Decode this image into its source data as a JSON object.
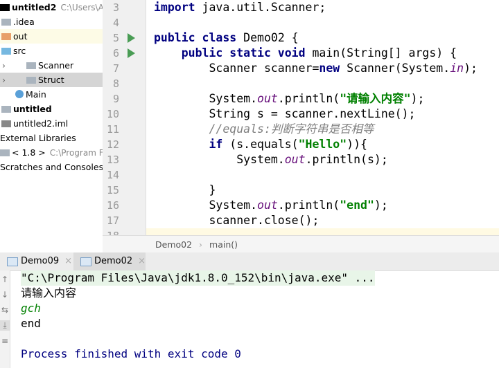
{
  "project_tree": [
    {
      "label": "untitled2",
      "hint": "C:\\Users\\Apple",
      "bold": true,
      "indent": 0,
      "icon": "folder-icon",
      "color": "#000"
    },
    {
      "label": ".idea",
      "indent": 1,
      "icon": "folder-icon",
      "color": "#aab4be"
    },
    {
      "label": "out",
      "indent": 1,
      "icon": "folder-orange-icon",
      "color": "#e8a06a",
      "highlight": true
    },
    {
      "label": "src",
      "indent": 1,
      "icon": "folder-blue-icon",
      "color": "#76b8e0"
    },
    {
      "label": "Scanner",
      "indent": 2,
      "icon": "package-icon",
      "color": "#aab4be",
      "arrow": true
    },
    {
      "label": "Struct",
      "indent": 2,
      "icon": "package-icon",
      "color": "#aab4be",
      "arrow": true,
      "selected": true
    },
    {
      "label": "Main",
      "indent": 2,
      "icon": "class-icon",
      "color": "#5aa0d8"
    },
    {
      "label": "untitled",
      "indent": 1,
      "icon": "module-icon",
      "bold": true,
      "color": "#aab4be"
    },
    {
      "label": "untitled2.iml",
      "indent": 1,
      "icon": "file-icon",
      "color": "#888"
    },
    {
      "label": "External Libraries",
      "indent": 0,
      "icon": "",
      "color": ""
    },
    {
      "label": "< 1.8 >",
      "hint": "C:\\Program Fi",
      "indent": 0,
      "icon": "library-icon",
      "color": "#aab4be"
    },
    {
      "label": "Scratches and Consoles",
      "indent": 0,
      "icon": "",
      "color": ""
    }
  ],
  "code_lines": [
    {
      "n": "3",
      "t": [
        [
          "import",
          "kw"
        ],
        [
          " java.util.Scanner;",
          ""
        ]
      ]
    },
    {
      "n": "4",
      "t": []
    },
    {
      "n": "5",
      "run": true,
      "t": [
        [
          "public class",
          "kw"
        ],
        [
          " Demo02 {",
          ""
        ]
      ]
    },
    {
      "n": "6",
      "run": true,
      "t": [
        [
          "    public static void",
          "kw"
        ],
        [
          " main(String[] args) {",
          ""
        ]
      ]
    },
    {
      "n": "7",
      "t": [
        [
          "        Scanner scanner=",
          ""
        ],
        [
          "new",
          "kw"
        ],
        [
          " Scanner(System.",
          ""
        ],
        [
          "in",
          "fld"
        ],
        [
          ");",
          ""
        ]
      ]
    },
    {
      "n": "8",
      "t": []
    },
    {
      "n": "9",
      "t": [
        [
          "        System.",
          ""
        ],
        [
          "out",
          "fld"
        ],
        [
          ".println(",
          ""
        ],
        [
          "\"请输入内容\"",
          "str"
        ],
        [
          ");",
          ""
        ]
      ]
    },
    {
      "n": "10",
      "t": [
        [
          "        String s = scanner.nextLine();",
          ""
        ]
      ]
    },
    {
      "n": "11",
      "t": [
        [
          "        //equals:判断字符串是否相等",
          "cm"
        ]
      ]
    },
    {
      "n": "12",
      "t": [
        [
          "        if",
          "kw"
        ],
        [
          " (s.equals(",
          ""
        ],
        [
          "\"Hello\"",
          "str"
        ],
        [
          ")){",
          ""
        ]
      ]
    },
    {
      "n": "13",
      "t": [
        [
          "            System.",
          ""
        ],
        [
          "out",
          "fld"
        ],
        [
          ".println(s);",
          ""
        ]
      ]
    },
    {
      "n": "14",
      "t": []
    },
    {
      "n": "15",
      "t": [
        [
          "        }",
          ""
        ]
      ]
    },
    {
      "n": "16",
      "t": [
        [
          "        System.",
          ""
        ],
        [
          "out",
          "fld"
        ],
        [
          ".println(",
          ""
        ],
        [
          "\"end\"",
          "str"
        ],
        [
          ");",
          ""
        ]
      ]
    },
    {
      "n": "17",
      "t": [
        [
          "        scanner.close();",
          ""
        ]
      ]
    },
    {
      "n": "18",
      "t": []
    }
  ],
  "breadcrumb": {
    "class": "Demo02",
    "sep": "›",
    "method": "main()"
  },
  "run_tabs": [
    {
      "label": "Demo09",
      "close": "×"
    },
    {
      "label": "Demo02",
      "close": "×"
    }
  ],
  "console": [
    {
      "text": "\"C:\\Program Files\\Java\\jdk1.8.0_152\\bin\\java.exe\" ...",
      "color": "#000",
      "bg": "#e8f5e8"
    },
    {
      "text": "请输入内容",
      "color": "#000"
    },
    {
      "text": "gch",
      "color": "#008000",
      "italic": true
    },
    {
      "text": "end",
      "color": "#000"
    },
    {
      "text": "",
      "color": "#000"
    },
    {
      "text": "Process finished with exit code 0",
      "color": "#000080"
    }
  ]
}
